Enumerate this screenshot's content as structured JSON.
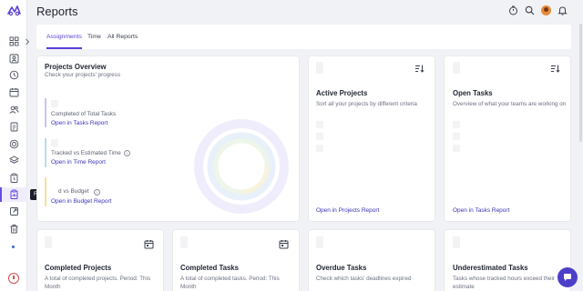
{
  "header": {
    "title": "Reports"
  },
  "tabs": [
    {
      "label": "Assignments",
      "active": true
    },
    {
      "label": "Time",
      "active": false
    },
    {
      "label": "All Reports",
      "active": false
    }
  ],
  "sidebar": {
    "tooltip": "Reports"
  },
  "overview": {
    "title": "Projects Overview",
    "subtitle": "Check your projects' progress",
    "items": [
      {
        "label": "Completed of Total Tasks",
        "link": "Open in Tasks Report"
      },
      {
        "label": "Tracked vs Estimated Time",
        "link": "Open in Time Report"
      },
      {
        "label": "d vs Budget",
        "link": "Open in Budget Report"
      }
    ]
  },
  "cards": {
    "active_projects": {
      "title": "Active Projects",
      "desc": "Sort all your projects by different criteria",
      "link": "Open in Projects Report"
    },
    "open_tasks": {
      "title": "Open Tasks",
      "desc": "Overview of what your teams are working on",
      "link": "Open in Tasks Report"
    },
    "completed_projects": {
      "title": "Completed Projects",
      "desc": "A total of completed projects. Period: This Month"
    },
    "completed_tasks": {
      "title": "Completed Tasks",
      "desc": "A total of completed tasks. Period: This Month"
    },
    "overdue_tasks": {
      "title": "Overdue Tasks",
      "desc": "Check which tasks' deadlines expired"
    },
    "underestimated_tasks": {
      "title": "Underestimated Tasks",
      "desc": "Tasks whose tracked hours exceed their estimate"
    }
  },
  "colors": {
    "accent": "#5b3fd9",
    "link": "#3e33b8",
    "bar_1": "#c9c2f2",
    "bar_2": "#bcd9f0",
    "bar_3": "#f1e39a"
  }
}
